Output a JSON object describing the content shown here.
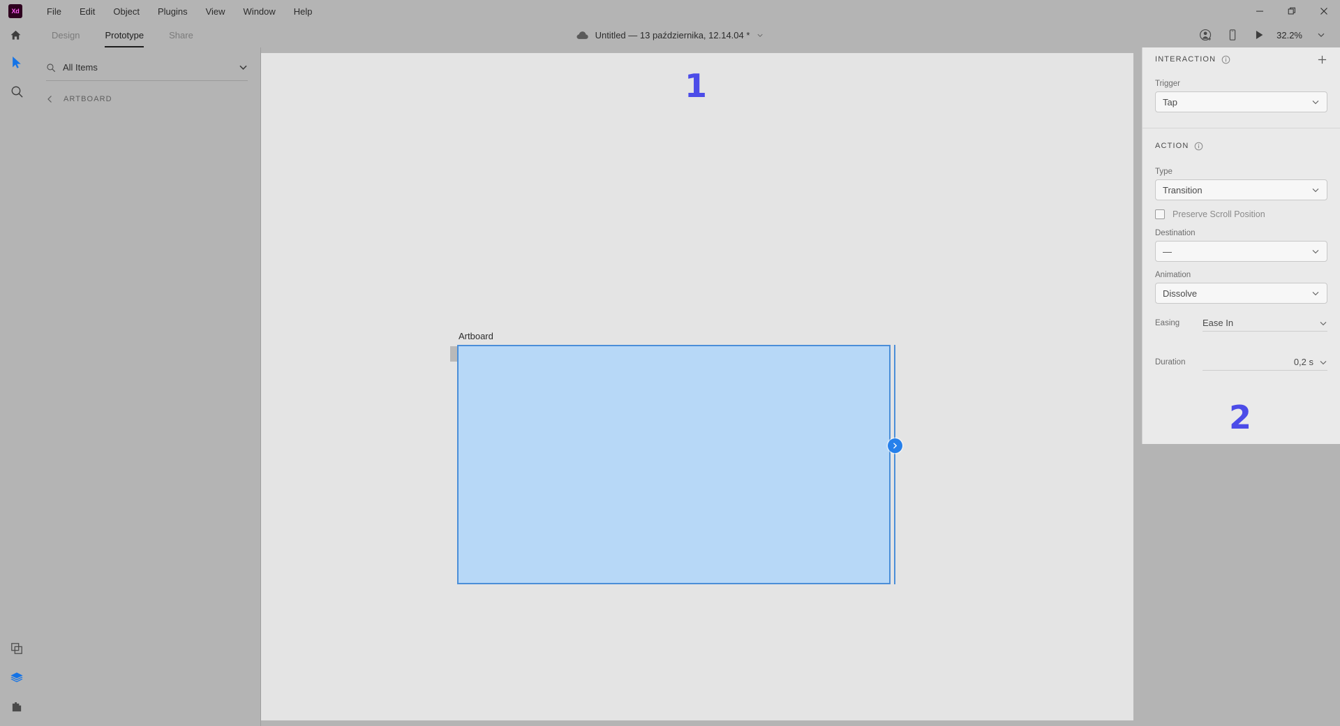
{
  "window": {
    "app_logo_text": "Xd",
    "controls": [
      {
        "name": "minimize",
        "glyph": "—"
      },
      {
        "name": "restore",
        "glyph": "❐"
      },
      {
        "name": "close",
        "glyph": "✕"
      }
    ]
  },
  "menubar": {
    "items": [
      "File",
      "Edit",
      "Object",
      "Plugins",
      "View",
      "Window",
      "Help"
    ]
  },
  "toolbar": {
    "tabs": [
      {
        "label": "Design",
        "active": false
      },
      {
        "label": "Prototype",
        "active": true
      },
      {
        "label": "Share",
        "active": false
      }
    ],
    "document_title": "Untitled — 13 października, 12.14.04 *",
    "cloud_icon": "cloud-icon",
    "title_chevron": "chevron-down-icon",
    "zoom_level": "32.2%",
    "right_icons": [
      "invite-user-icon",
      "device-preview-icon",
      "play-icon"
    ]
  },
  "left_rail": {
    "top_tools": [
      "select-tool-icon",
      "zoom-tool-icon"
    ],
    "bottom_tools": [
      "components-icon",
      "layers-icon",
      "plugins-icon"
    ]
  },
  "left_panel": {
    "search": {
      "placeholder": "All Items",
      "value": "All Items",
      "icon": "search-icon",
      "chevron": "chevron-down-icon"
    },
    "breadcrumb": {
      "back_icon": "chevron-left-icon",
      "label": "ARTBOARD"
    }
  },
  "canvas": {
    "artboard_label": "Artboard",
    "connector_icon": "chevron-right-icon",
    "artboard_fill": "#b7d8f7",
    "artboard_border": "#4b8ed8",
    "background": "#e4e4e4"
  },
  "inspector": {
    "interaction": {
      "title": "INTERACTION",
      "info_icon": "info-icon",
      "add_icon": "plus-icon",
      "trigger_label": "Trigger",
      "trigger_value": "Tap"
    },
    "action": {
      "title": "ACTION",
      "info_icon": "info-icon",
      "type_label": "Type",
      "type_value": "Transition",
      "preserve_scroll_label": "Preserve Scroll Position",
      "preserve_scroll_checked": false,
      "destination_label": "Destination",
      "destination_value": "—",
      "animation_label": "Animation",
      "animation_value": "Dissolve",
      "easing_label": "Easing",
      "easing_value": "Ease In",
      "duration_label": "Duration",
      "duration_value": "0,2 s"
    }
  },
  "annotations": [
    {
      "id": "1",
      "text": "1",
      "color": "#4c4ce8"
    },
    {
      "id": "2",
      "text": "2",
      "color": "#4c4ce8"
    }
  ]
}
